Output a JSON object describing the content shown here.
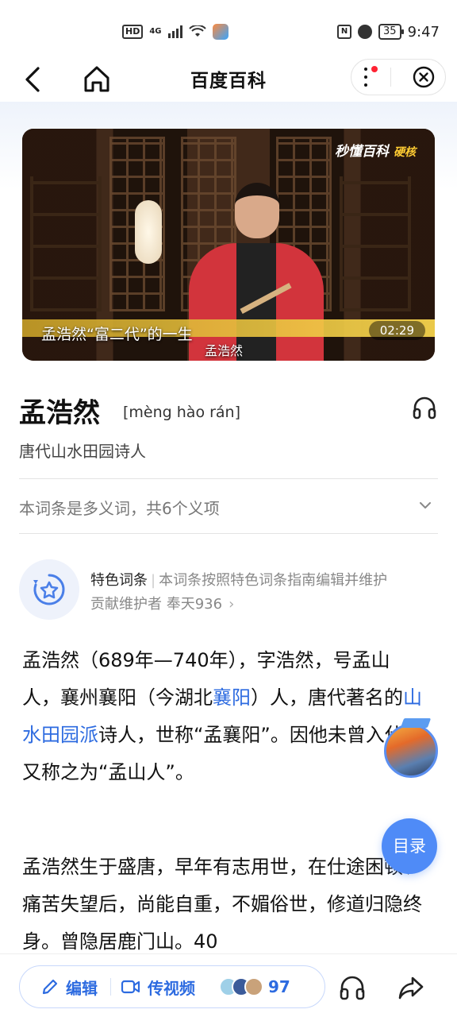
{
  "status_bar": {
    "hd": "HD",
    "signal": "4G",
    "nfc": "N",
    "battery": "35",
    "time": "9:47"
  },
  "nav": {
    "title": "百度百科"
  },
  "video": {
    "brand": "秒懂百科",
    "brand_tag": "硬核",
    "title": "孟浩然“富二代”的一生",
    "caption": "孟浩然",
    "duration": "02:29"
  },
  "entry": {
    "title": "孟浩然",
    "pinyin": "[mèng hào rán]",
    "subtitle": "唐代山水田园诗人"
  },
  "polysemy": {
    "text": "本词条是多义词，共6个义项"
  },
  "feature": {
    "label": "特色词条",
    "separator": "|",
    "desc": "本词条按照特色词条指南编辑并维护",
    "maintainer": "贡献维护者 奉天936",
    "chevron": "›"
  },
  "body": {
    "p1": [
      {
        "text": "孟浩然（689年—740年），字浩然，号孟山人，襄州襄阳（今湖北"
      },
      {
        "text": "襄阳",
        "link": true
      },
      {
        "text": "）人，唐代著名的"
      },
      {
        "text": "山水田园派",
        "link": true
      },
      {
        "text": "诗人，世称“孟襄阳”。因他未曾入仕，又称之为“孟山人”。"
      }
    ],
    "p2": "孟浩然生于盛唐，早年有志用世，在仕途困顿、痛苦失望后，尚能自重，不媚俗世，修道归隐终身。曾隐居鹿门山。40"
  },
  "floating": {
    "toc": "目录"
  },
  "bottom_bar": {
    "edit": "编辑",
    "upload_video": "传视频",
    "contributor_count": "97"
  },
  "colors": {
    "accent": "#2d6be0",
    "toc_button": "#4f8bf7",
    "badge_red": "#ff2233"
  }
}
